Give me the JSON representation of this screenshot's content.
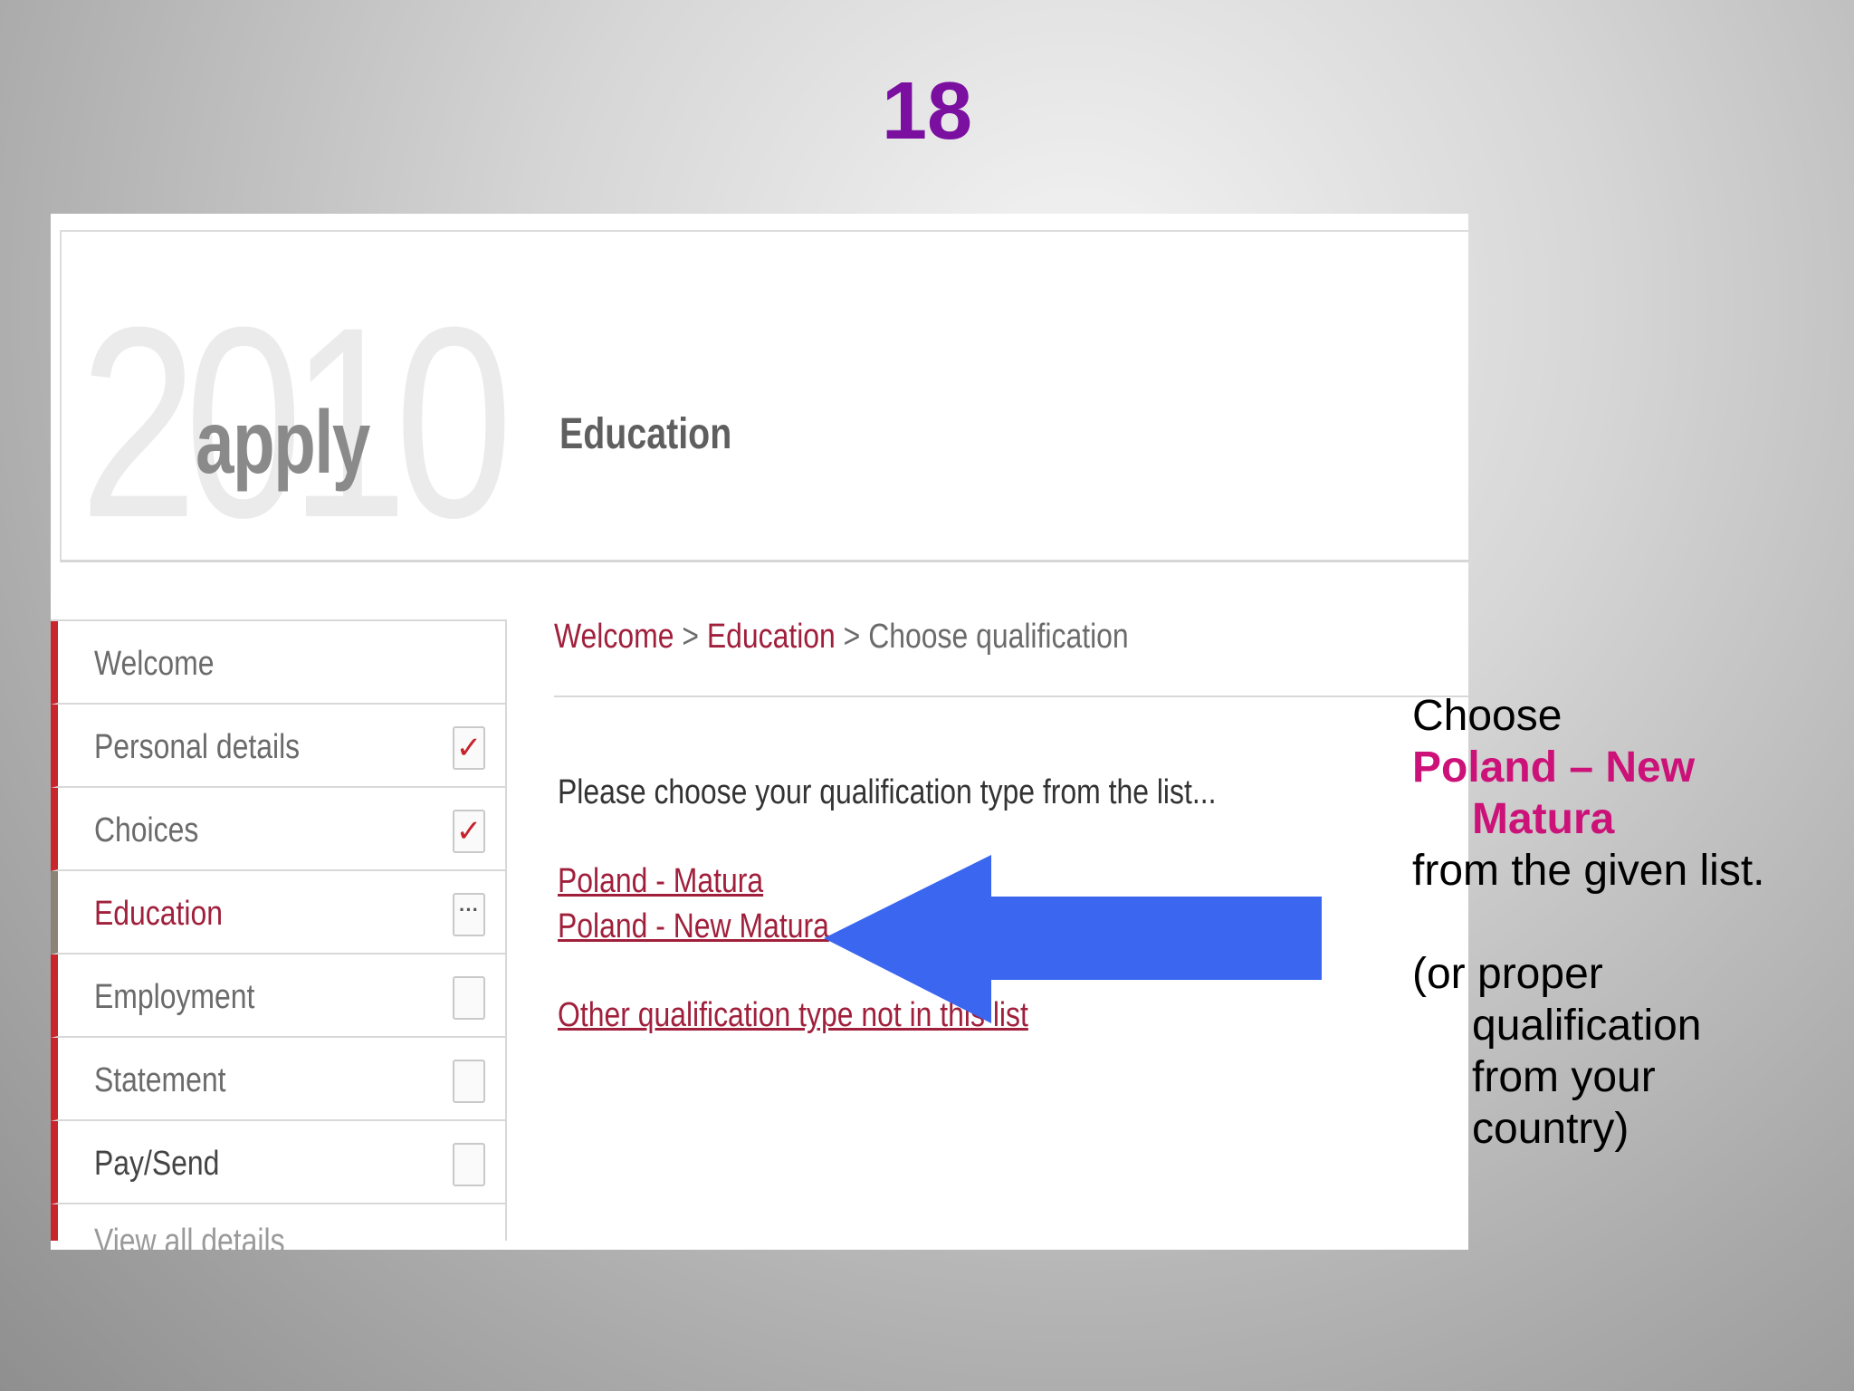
{
  "slide": {
    "number": "18"
  },
  "header": {
    "logo_year": "2010",
    "logo_word": "apply",
    "title": "Education"
  },
  "nav": {
    "items": [
      {
        "label": "Welcome",
        "status": ""
      },
      {
        "label": "Personal details",
        "status": "✓"
      },
      {
        "label": "Choices",
        "status": "✓"
      },
      {
        "label": "Education",
        "status": "···"
      },
      {
        "label": "Employment",
        "status": ""
      },
      {
        "label": "Statement",
        "status": ""
      },
      {
        "label": "Pay/Send",
        "status": ""
      }
    ],
    "cut_item": "View all details"
  },
  "breadcrumb": {
    "welcome": "Welcome",
    "sep": " > ",
    "education": "Education",
    "current": "Choose qualification"
  },
  "main": {
    "prompt": "Please choose your qualification type from the list...",
    "links": [
      "Poland - Matura",
      "Poland - New Matura"
    ],
    "other_link": "Other qualification type not in this list"
  },
  "annotation": {
    "arrow_color": "#3a66f0",
    "line1": "Choose",
    "highlight_a": "Poland – New",
    "highlight_b": "Matura",
    "line2": "from the given list.",
    "line3": "(or proper",
    "line4": "qualification",
    "line5": "from your",
    "line6": "country)"
  },
  "colors": {
    "slide_number": "#7a0fa0",
    "link": "#a0203c",
    "highlight": "#cc1178"
  }
}
